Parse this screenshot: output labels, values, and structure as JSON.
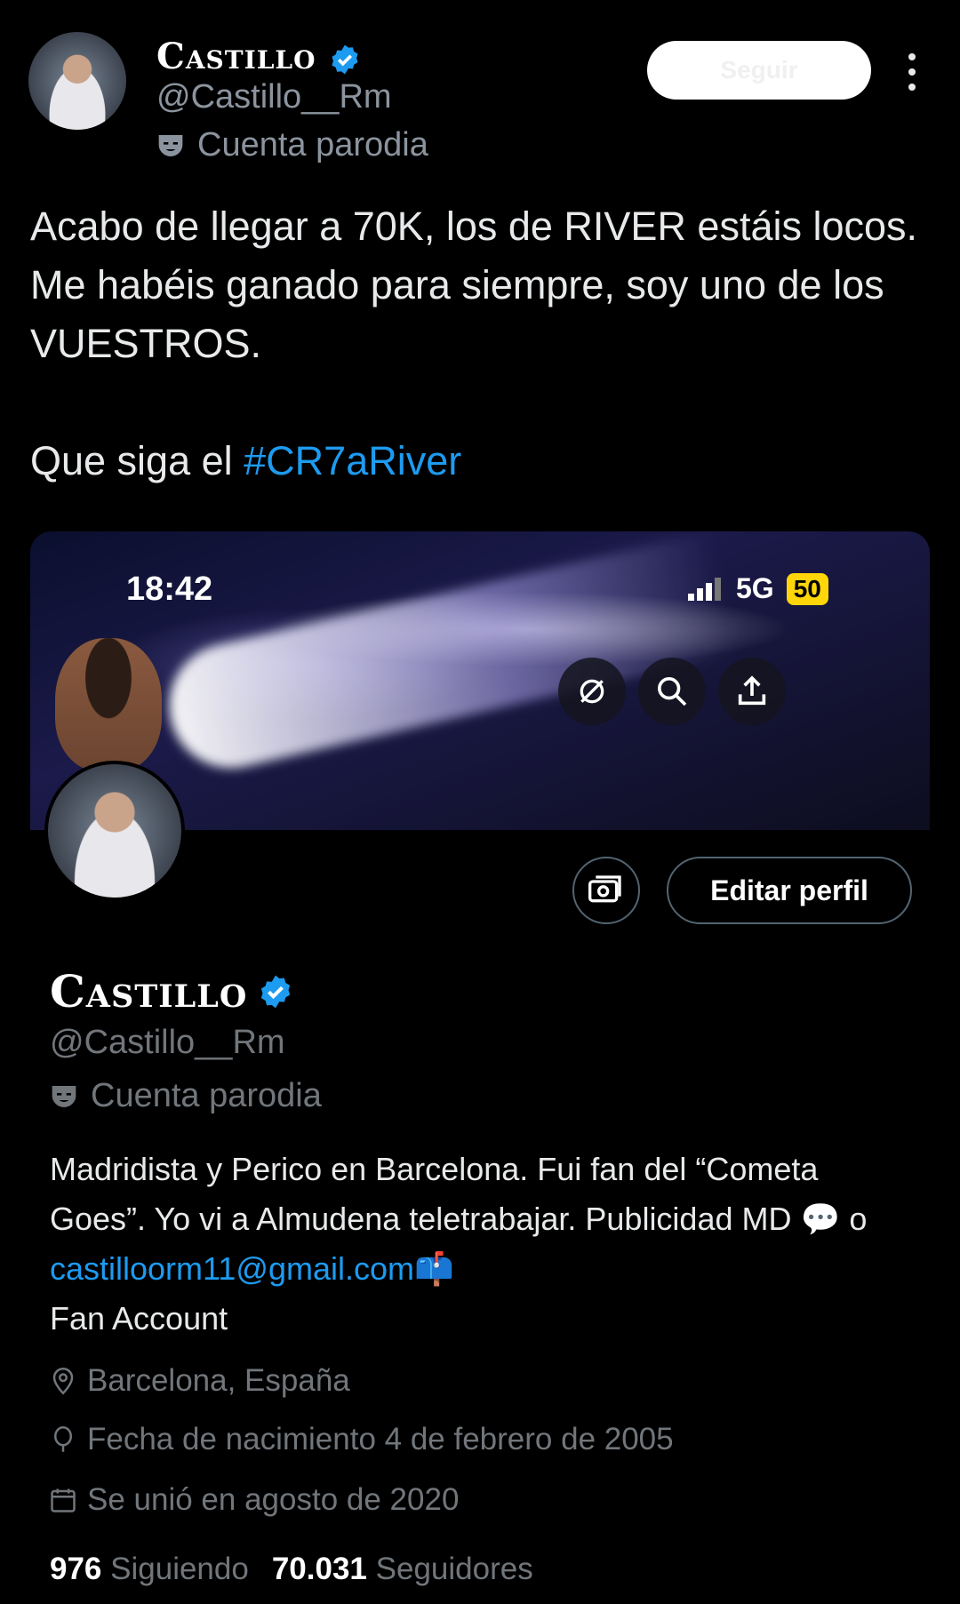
{
  "tweet": {
    "display_name": "Castillo",
    "handle": "@Castillo__Rm",
    "parody_label": "Cuenta parodia",
    "follow_label": "Seguir",
    "text_line1": "Acabo de llegar a 70K, los de RIVER estáis locos. Me habéis ganado para siempre, soy uno de los VUESTROS.",
    "text_line2_prefix": "Que siga el ",
    "hashtag": "#CR7aRiver"
  },
  "screenshot": {
    "status_time": "18:42",
    "network": "5G",
    "battery": "50",
    "profile": {
      "display_name": "Castillo",
      "handle": "@Castillo__Rm",
      "parody_label": "Cuenta parodia",
      "edit_label": "Editar perfil",
      "bio_part1": "Madridista y Perico en Barcelona. Fui fan del “Cometa Goes”. Yo vi a Almudena teletrabajar. Publicidad MD ",
      "bio_emoji": "💬",
      "bio_part2": " o ",
      "bio_email": "castilloorm11@gmail.com",
      "bio_mailbox": "📫",
      "bio_part3": "Fan Account",
      "location": "Barcelona, España",
      "birthdate": "Fecha de nacimiento 4 de febrero de 2005",
      "joined": "Se unió en agosto de 2020",
      "following_count": "976",
      "following_label": "Siguiendo",
      "followers_count": "70.031",
      "followers_label": "Seguidores"
    }
  },
  "colors": {
    "accent": "#1d9bf0",
    "muted": "#71767b",
    "background": "#000000"
  }
}
